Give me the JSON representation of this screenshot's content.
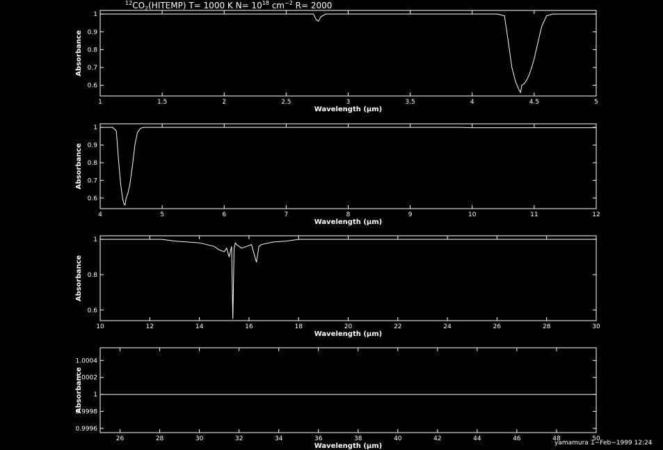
{
  "figure": {
    "title_prefix": "12",
    "title_species": "CO",
    "title_sub": "2",
    "title_mid": "(HITEMP) T= 1000 K N= 10",
    "title_exp1": "18",
    "title_mid2": " cm",
    "title_exp2": "−2",
    "title_end": " R= 2000",
    "footer_user": "yamamura",
    "footer_date": "1−Feb−1999 12:24"
  },
  "colors": {
    "background": "#000000",
    "foreground": "#ffffff"
  },
  "chart_data": [
    {
      "type": "line",
      "xlabel": "Wavelength (μm)",
      "ylabel": "Absorbance",
      "xlim": [
        1,
        5
      ],
      "ylim": [
        0.54,
        1.02
      ],
      "xticks": [
        1,
        1.5,
        2,
        2.5,
        3,
        3.5,
        4,
        4.5,
        5
      ],
      "xticklabels": [
        "1",
        "1.5",
        "2",
        "2.5",
        "3",
        "3.5",
        "4",
        "4.5",
        "5"
      ],
      "yticks": [
        0.6,
        0.7,
        0.8,
        0.9,
        1
      ],
      "yticklabels": [
        "0.6",
        "0.7",
        "0.8",
        "0.9",
        "1"
      ],
      "series": [
        {
          "x": [
            1,
            2.72,
            2.74,
            2.76,
            2.78,
            2.82,
            4.2,
            4.26,
            4.29,
            4.32,
            4.35,
            4.38,
            4.39,
            4.4,
            4.42,
            4.44,
            4.46,
            4.48,
            4.5,
            4.53,
            4.56,
            4.6,
            4.65,
            5
          ],
          "y": [
            1,
            1,
            0.97,
            0.96,
            0.985,
            1,
            1,
            0.99,
            0.85,
            0.7,
            0.62,
            0.57,
            0.56,
            0.6,
            0.61,
            0.63,
            0.66,
            0.7,
            0.75,
            0.84,
            0.93,
            0.99,
            1,
            1
          ]
        }
      ]
    },
    {
      "type": "line",
      "xlabel": "Wavelength (μm)",
      "ylabel": "Absorbance",
      "xlim": [
        4,
        12
      ],
      "ylim": [
        0.54,
        1.02
      ],
      "xticks": [
        4,
        5,
        6,
        7,
        8,
        9,
        10,
        11,
        12
      ],
      "xticklabels": [
        "4",
        "5",
        "6",
        "7",
        "8",
        "9",
        "10",
        "11",
        "12"
      ],
      "yticks": [
        0.6,
        0.7,
        0.8,
        0.9,
        1
      ],
      "yticklabels": [
        "0.6",
        "0.7",
        "0.8",
        "0.9",
        "1"
      ],
      "series": [
        {
          "x": [
            4,
            4.2,
            4.26,
            4.3,
            4.33,
            4.36,
            4.38,
            4.4,
            4.42,
            4.45,
            4.48,
            4.52,
            4.56,
            4.6,
            4.65,
            4.7,
            9.8,
            10,
            12
          ],
          "y": [
            1,
            1,
            0.98,
            0.8,
            0.68,
            0.6,
            0.57,
            0.56,
            0.6,
            0.63,
            0.68,
            0.78,
            0.9,
            0.97,
            0.995,
            1,
            1,
            0.998,
            0.998
          ]
        }
      ]
    },
    {
      "type": "line",
      "xlabel": "Wavelength (μm)",
      "ylabel": "Absorbance",
      "xlim": [
        10,
        30
      ],
      "ylim": [
        0.54,
        1.02
      ],
      "xticks": [
        10,
        12,
        14,
        16,
        18,
        20,
        22,
        24,
        26,
        28,
        30
      ],
      "xticklabels": [
        "10",
        "12",
        "14",
        "16",
        "18",
        "20",
        "22",
        "24",
        "26",
        "28",
        "30"
      ],
      "yticks": [
        0.6,
        0.8,
        1
      ],
      "yticklabels": [
        "0.6",
        "0.8",
        "1"
      ],
      "series": [
        {
          "x": [
            10,
            12.5,
            13,
            13.5,
            14,
            14.3,
            14.6,
            14.8,
            15,
            15.1,
            15.2,
            15.3,
            15.35,
            15.4,
            15.45,
            15.5,
            15.7,
            15.9,
            16.1,
            16.3,
            16.4,
            16.5,
            16.8,
            17,
            17.5,
            18,
            30
          ],
          "y": [
            1,
            1,
            0.99,
            0.985,
            0.98,
            0.97,
            0.96,
            0.94,
            0.93,
            0.95,
            0.9,
            0.96,
            0.55,
            0.95,
            0.98,
            0.97,
            0.95,
            0.96,
            0.97,
            0.87,
            0.96,
            0.97,
            0.98,
            0.985,
            0.99,
            1,
            1
          ]
        }
      ]
    },
    {
      "type": "line",
      "xlabel": "Wavelength (μm)",
      "ylabel": "Absorbance",
      "xlim": [
        25,
        50
      ],
      "ylim": [
        0.99955,
        1.00055
      ],
      "xticks": [
        26,
        28,
        30,
        32,
        34,
        36,
        38,
        40,
        42,
        44,
        46,
        48,
        50
      ],
      "xticklabels": [
        "26",
        "28",
        "30",
        "32",
        "34",
        "36",
        "38",
        "40",
        "42",
        "44",
        "46",
        "48",
        "50"
      ],
      "yticks": [
        0.9996,
        0.9998,
        1,
        1.0002,
        1.0004
      ],
      "yticklabels": [
        "0.9996",
        "0.9998",
        "1",
        "1.0002",
        "1.0004"
      ],
      "series": [
        {
          "x": [
            25,
            50
          ],
          "y": [
            1,
            1
          ]
        }
      ]
    }
  ]
}
